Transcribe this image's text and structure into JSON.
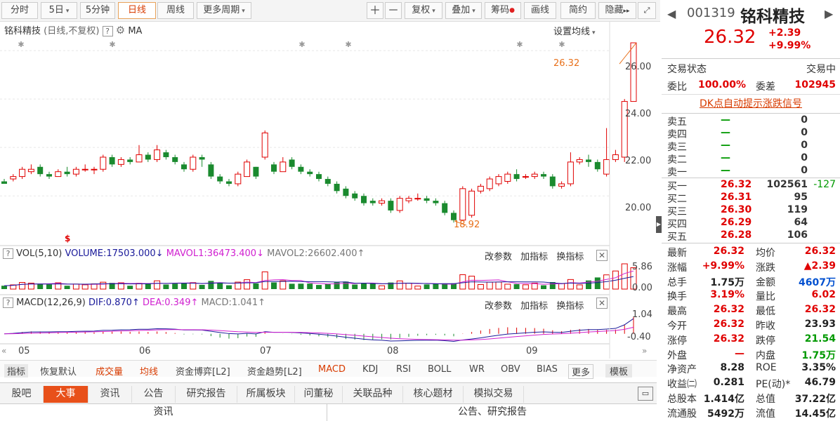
{
  "toolbar": {
    "buttons": [
      "分时",
      "5日",
      "5分钟",
      "日线",
      "周线",
      "更多周期"
    ],
    "tools": [
      "复权",
      "叠加",
      "筹码",
      "画线",
      "简约",
      "隐藏"
    ]
  },
  "chart": {
    "title": "铭科精技",
    "subtitle": "(日线,不复权)",
    "ma_label": "MA",
    "ma_setting": "设置均线",
    "y_labels": [
      "26.00",
      "24.00",
      "22.00",
      "20.00"
    ],
    "last_price_label": "26.32",
    "low_label": "18.92",
    "x_labels": [
      "05",
      "06",
      "07",
      "08",
      "09"
    ]
  },
  "vol_panel": {
    "name": "VOL(5,10)",
    "volume": "VOLUME:17503.000",
    "mavol1": "MAVOL1:36473.400",
    "mavol2": "MAVOL2:26602.400",
    "y_top": "5.86",
    "y_bottom": "0.00"
  },
  "macd_panel": {
    "name": "MACD(12,26,9)",
    "dif": "DIF:0.870",
    "dea": "DEA:0.349",
    "macd": "MACD:1.041",
    "y_top": "1.04",
    "y_bottom": "-0.40"
  },
  "panel_actions": [
    "改参数",
    "加指标",
    "换指标"
  ],
  "indicator_tabs": [
    "指标",
    "恢复默认",
    "成交量",
    "均线",
    "资金博弈[L2]",
    "资金趋势[L2]",
    "MACD",
    "KDJ",
    "RSI",
    "BOLL",
    "WR",
    "OBV",
    "BIAS",
    "更多",
    "模板"
  ],
  "bottom_tabs": [
    "股吧",
    "大事",
    "资讯",
    "公告",
    "研究报告",
    "所属板块",
    "问董秘",
    "关联品种",
    "核心题材",
    "模拟交易"
  ],
  "bottom_sections": [
    "资讯",
    "公告、研究报告"
  ],
  "quote": {
    "code": "001319",
    "name": "铭科精技",
    "price": "26.32",
    "change": "+2.39",
    "change_pct": "+9.99%",
    "status_label": "交易状态",
    "status_value": "交易中",
    "weibi_label": "委比",
    "weibi_value": "100.00%",
    "weicha_label": "委差",
    "weicha_value": "102945",
    "dk_signal": "DK点自动提示涨跌信号",
    "sells": [
      {
        "label": "卖五",
        "price": "—",
        "vol": "0"
      },
      {
        "label": "卖四",
        "price": "—",
        "vol": "0"
      },
      {
        "label": "卖三",
        "price": "—",
        "vol": "0"
      },
      {
        "label": "卖二",
        "price": "—",
        "vol": "0"
      },
      {
        "label": "卖一",
        "price": "—",
        "vol": "0"
      }
    ],
    "buys": [
      {
        "label": "买一",
        "price": "26.32",
        "vol": "102561",
        "chg": "-127"
      },
      {
        "label": "买二",
        "price": "26.31",
        "vol": "95",
        "chg": ""
      },
      {
        "label": "买三",
        "price": "26.30",
        "vol": "119",
        "chg": ""
      },
      {
        "label": "买四",
        "price": "26.29",
        "vol": "64",
        "chg": ""
      },
      {
        "label": "买五",
        "price": "26.28",
        "vol": "106",
        "chg": ""
      }
    ],
    "stats": [
      [
        "最新",
        "26.32",
        "均价",
        "26.32"
      ],
      [
        "涨幅",
        "+9.99%",
        "涨跌",
        "▲2.39"
      ],
      [
        "总手",
        "1.75万",
        "金额",
        "4607万"
      ],
      [
        "换手",
        "3.19%",
        "量比",
        "6.02"
      ],
      [
        "最高",
        "26.32",
        "最低",
        "26.32"
      ],
      [
        "今开",
        "26.32",
        "昨收",
        "23.93"
      ],
      [
        "涨停",
        "26.32",
        "跌停",
        "21.54"
      ],
      [
        "外盘",
        "—",
        "内盘",
        "1.75万"
      ],
      [
        "净资产",
        "8.28",
        "ROE",
        "3.35%"
      ],
      [
        "收益㈡",
        "0.281",
        "PE(动)*",
        "46.79"
      ],
      [
        "总股本",
        "1.414亿",
        "总值",
        "37.22亿"
      ],
      [
        "流通股",
        "5492万",
        "流值",
        "14.45亿"
      ]
    ]
  },
  "colors": {
    "up": "#e00000",
    "down": "#1a8a2e",
    "accent": "#e8701a"
  },
  "chart_data": {
    "type": "candlestick",
    "ylim": [
      18.5,
      26.9
    ],
    "candles": [
      [
        20.6,
        20.5,
        20.7,
        20.6
      ],
      [
        20.7,
        20.8,
        20.9,
        20.6
      ],
      [
        20.8,
        21.1,
        21.2,
        20.7
      ],
      [
        21.0,
        21.1,
        21.3,
        20.9
      ],
      [
        21.2,
        20.9,
        21.3,
        20.8
      ],
      [
        20.9,
        20.8,
        21.0,
        20.7
      ],
      [
        20.8,
        21.0,
        21.1,
        20.8
      ],
      [
        21.0,
        20.9,
        21.2,
        20.8
      ],
      [
        20.9,
        21.1,
        21.2,
        20.8
      ],
      [
        21.1,
        21.1,
        21.3,
        21.0
      ],
      [
        21.1,
        21.1,
        21.2,
        20.9
      ],
      [
        21.1,
        21.6,
        21.7,
        21.0
      ],
      [
        21.6,
        21.3,
        21.7,
        21.2
      ],
      [
        21.3,
        21.5,
        21.6,
        21.2
      ],
      [
        21.5,
        21.4,
        21.6,
        21.3
      ],
      [
        21.4,
        21.7,
        22.1,
        21.4
      ],
      [
        21.7,
        21.5,
        21.8,
        21.4
      ],
      [
        21.5,
        21.9,
        22.1,
        21.4
      ],
      [
        21.8,
        21.6,
        21.9,
        21.5
      ],
      [
        21.6,
        21.4,
        21.7,
        21.3
      ],
      [
        21.3,
        21.1,
        21.4,
        21.0
      ],
      [
        21.1,
        21.6,
        21.7,
        21.0
      ],
      [
        21.6,
        21.5,
        21.7,
        21.2
      ],
      [
        21.3,
        20.8,
        21.4,
        20.7
      ],
      [
        20.8,
        20.6,
        20.9,
        20.5
      ],
      [
        20.6,
        20.5,
        20.7,
        20.4
      ],
      [
        20.5,
        20.9,
        21.0,
        20.4
      ],
      [
        20.8,
        21.4,
        21.5,
        20.8
      ],
      [
        21.2,
        20.8,
        21.2,
        20.7
      ],
      [
        21.6,
        22.6,
        22.7,
        21.5
      ],
      [
        21.3,
        21.0,
        21.4,
        20.9
      ],
      [
        21.0,
        21.4,
        21.6,
        21.0
      ],
      [
        21.5,
        21.2,
        21.6,
        21.1
      ],
      [
        21.2,
        21.0,
        21.3,
        20.9
      ],
      [
        21.0,
        20.9,
        21.1,
        20.8
      ],
      [
        20.9,
        20.7,
        21.0,
        20.6
      ],
      [
        20.7,
        20.5,
        20.8,
        20.4
      ],
      [
        20.5,
        20.2,
        20.6,
        20.1
      ],
      [
        20.3,
        20.0,
        20.4,
        19.9
      ],
      [
        20.1,
        19.9,
        20.2,
        19.8
      ],
      [
        20.0,
        19.7,
        20.1,
        19.6
      ],
      [
        19.8,
        19.7,
        19.9,
        19.6
      ],
      [
        19.7,
        19.8,
        19.9,
        19.6
      ],
      [
        19.8,
        19.4,
        19.9,
        19.3
      ],
      [
        19.4,
        19.9,
        20.0,
        19.3
      ],
      [
        19.8,
        19.9,
        20.0,
        19.7
      ],
      [
        19.9,
        19.9,
        20.1,
        19.8
      ],
      [
        19.9,
        19.8,
        20.0,
        19.7
      ],
      [
        19.8,
        19.7,
        19.9,
        19.6
      ],
      [
        19.7,
        19.3,
        19.8,
        19.2
      ],
      [
        19.3,
        19.0,
        19.4,
        18.9
      ],
      [
        19.0,
        20.3,
        20.4,
        19.0
      ],
      [
        19.2,
        20.2,
        20.3,
        19.1
      ],
      [
        20.2,
        20.4,
        20.5,
        20.1
      ],
      [
        20.3,
        20.7,
        20.8,
        20.2
      ],
      [
        20.5,
        20.8,
        20.9,
        20.4
      ],
      [
        20.6,
        20.9,
        21.0,
        20.5
      ],
      [
        20.9,
        20.7,
        21.1,
        20.6
      ],
      [
        20.8,
        20.8,
        20.9,
        20.7
      ],
      [
        20.8,
        20.9,
        21.0,
        20.7
      ],
      [
        20.9,
        20.8,
        21.0,
        20.7
      ],
      [
        20.8,
        20.4,
        20.9,
        20.3
      ],
      [
        20.4,
        20.5,
        20.6,
        20.3
      ],
      [
        20.5,
        21.4,
        21.8,
        20.4
      ],
      [
        21.4,
        21.5,
        21.6,
        21.3
      ],
      [
        21.5,
        21.4,
        21.7,
        21.2
      ],
      [
        21.4,
        21.1,
        21.5,
        21.0
      ],
      [
        20.9,
        21.5,
        22.8,
        20.8
      ],
      [
        21.5,
        21.7,
        21.9,
        21.4
      ],
      [
        21.6,
        23.9,
        24.0,
        21.4
      ],
      [
        23.9,
        26.32,
        26.32,
        26.32
      ]
    ],
    "volume_ylim": [
      0,
      5.86
    ],
    "macd_ylim": [
      -0.4,
      1.04
    ]
  }
}
